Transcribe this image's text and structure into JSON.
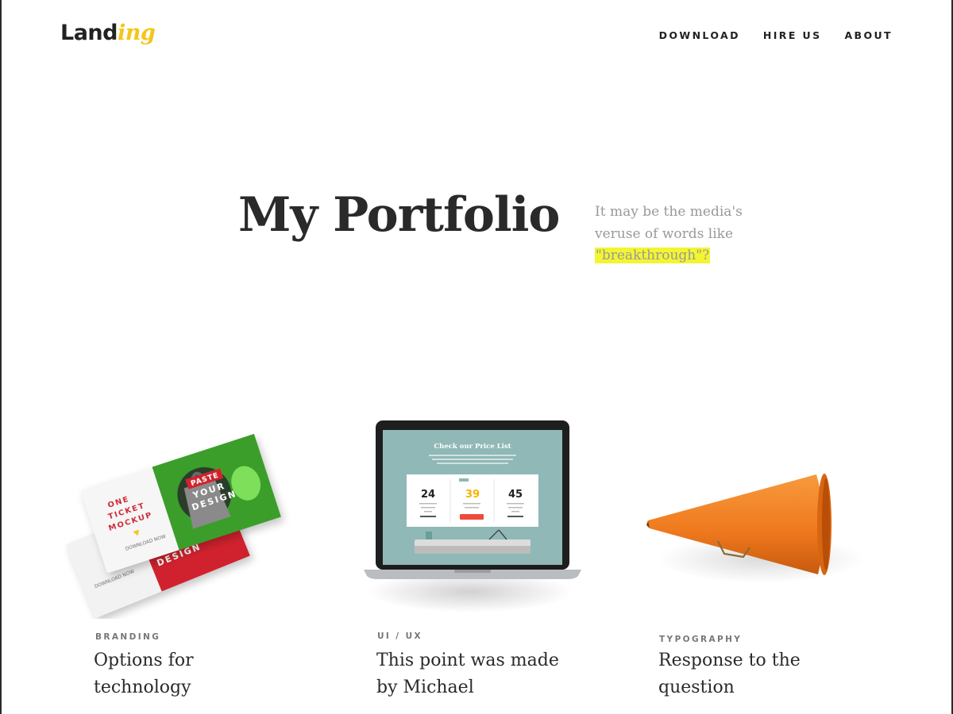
{
  "logo": {
    "text": "Land",
    "accent_text": "ing",
    "accent_color": "#f5c518"
  },
  "nav": {
    "items": [
      {
        "label": "DOWNLOAD"
      },
      {
        "label": "HIRE US"
      },
      {
        "label": "ABOUT"
      }
    ]
  },
  "hero": {
    "title": "My Portfolio",
    "subtitle_plain": "It may be the media's veruse of words like",
    "subtitle_highlight": "\"breakthrough\"?",
    "highlight_color": "#f3f533"
  },
  "cards": [
    {
      "category": "BRANDING",
      "title": "Options for technology",
      "image": "ticket-mockup",
      "image_text": {
        "line1": "ONE",
        "line2": "TICKET",
        "line3": "MOCKUP",
        "paste1": "PASTE",
        "paste2": "YOUR",
        "paste3": "DESIGN",
        "download": "DOWNLOAD NOW"
      }
    },
    {
      "category": "UI / UX",
      "title": "This point was made by Michael",
      "image": "laptop-price-list",
      "image_text": {
        "heading": "Check our Price List",
        "plans": [
          {
            "price": "24"
          },
          {
            "price": "39"
          },
          {
            "price": "45"
          }
        ],
        "button": "LEARN MORE"
      }
    },
    {
      "category": "TYPOGRAPHY",
      "title": "Response to the question",
      "image": "megaphone"
    }
  ],
  "colors": {
    "text_dark": "#2a2a2a",
    "text_muted": "#999999",
    "ticket_green": "#3a9e2a",
    "ticket_red": "#d0202e",
    "laptop_screen": "#8fb8b7",
    "megaphone_orange": "#f07a1e"
  }
}
